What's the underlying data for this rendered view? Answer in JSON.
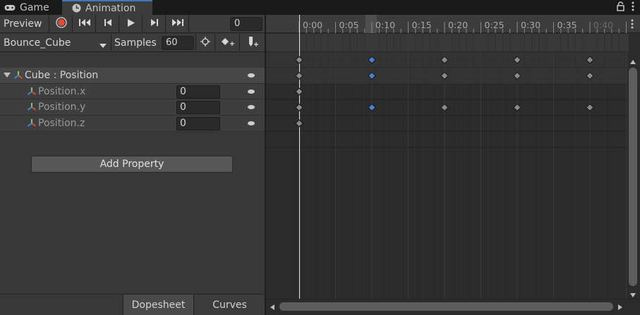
{
  "tabs": [
    {
      "label": "Game",
      "icon": "gamepad-icon"
    },
    {
      "label": "Animation",
      "icon": "clock-icon",
      "active": true
    }
  ],
  "toolbar": {
    "preview_label": "Preview",
    "frame_value": "0",
    "clip_name": "Bounce_Cube",
    "samples_label": "Samples",
    "samples_value": "60"
  },
  "hierarchy": {
    "group_label": "Cube : Position",
    "properties": [
      {
        "label": "Position.x",
        "value": "0"
      },
      {
        "label": "Position.y",
        "value": "0"
      },
      {
        "label": "Position.z",
        "value": "0"
      }
    ]
  },
  "add_property_label": "Add Property",
  "bottom_tabs": {
    "dopesheet": "Dopesheet",
    "curves": "Curves"
  },
  "ruler": {
    "labels": [
      "0:00",
      "0:05",
      "0:10",
      "0:15",
      "0:20",
      "0:25",
      "0:30",
      "0:35",
      "0:40"
    ]
  },
  "keyframes": {
    "summary": [
      {
        "t": 0,
        "selected": false
      },
      {
        "t": 10,
        "selected": true
      },
      {
        "t": 20,
        "selected": false
      },
      {
        "t": 30,
        "selected": false
      },
      {
        "t": 40,
        "selected": false
      }
    ],
    "group": [
      {
        "t": 0,
        "selected": false
      },
      {
        "t": 10,
        "selected": true
      },
      {
        "t": 20,
        "selected": false
      },
      {
        "t": 30,
        "selected": false
      },
      {
        "t": 40,
        "selected": false
      }
    ],
    "x": [
      {
        "t": 0,
        "selected": false
      }
    ],
    "y": [
      {
        "t": 0,
        "selected": false
      },
      {
        "t": 10,
        "selected": true
      },
      {
        "t": 20,
        "selected": false
      },
      {
        "t": 30,
        "selected": false
      },
      {
        "t": 40,
        "selected": false
      }
    ],
    "z": [
      {
        "t": 0,
        "selected": false
      }
    ]
  },
  "colors": {
    "key_default": "#8a8a8a",
    "key_selected": "#4c7fd6",
    "record": "#e04a3a",
    "tab_accent": "#3a79bb"
  }
}
